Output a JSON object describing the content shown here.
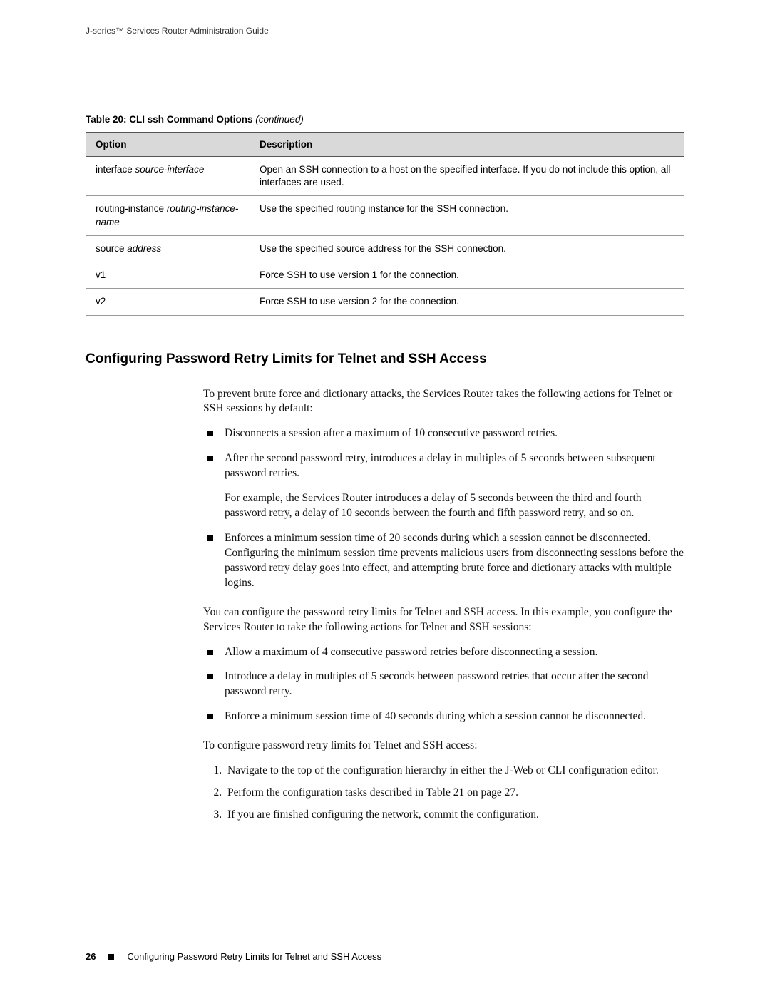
{
  "header": {
    "running": "J-series™ Services Router Administration Guide"
  },
  "table": {
    "caption_bold": "Table 20: CLI ssh Command Options",
    "caption_ital": " (continued)",
    "head_option": "Option",
    "head_desc": "Description",
    "rows": [
      {
        "opt_base": "interface ",
        "opt_param": "source-interface",
        "desc": "Open an SSH connection to a host on the specified interface. If you do not include this option, all interfaces are used."
      },
      {
        "opt_base": "routing-instance ",
        "opt_param": "routing-instance-name",
        "desc": "Use the specified routing instance for the SSH connection."
      },
      {
        "opt_base": "source ",
        "opt_param": "address",
        "desc": "Use the specified source address for the SSH connection."
      },
      {
        "opt_base": "v1",
        "opt_param": "",
        "desc": "Force SSH to use version 1 for the connection."
      },
      {
        "opt_base": "v2",
        "opt_param": "",
        "desc": "Force SSH to use version 2 for the connection."
      }
    ]
  },
  "section": {
    "heading": "Configuring Password Retry Limits for Telnet and SSH Access",
    "intro": "To prevent brute force and dictionary attacks, the Services Router takes the following actions for Telnet or SSH sessions by default:",
    "defaults": [
      {
        "text": "Disconnects a session after a maximum of 10 consecutive password retries."
      },
      {
        "text": "After the second password retry, introduces a delay in multiples of 5 seconds between subsequent password retries.",
        "sub": "For example, the Services Router introduces a delay of 5 seconds between the third and fourth password retry, a delay of 10 seconds between the fourth and fifth password retry, and so on."
      },
      {
        "text": "Enforces a minimum session time of 20 seconds during which a session cannot be disconnected. Configuring the minimum session time prevents malicious users from disconnecting sessions before the password retry delay goes into effect, and attempting brute force and dictionary attacks with multiple logins."
      }
    ],
    "example_intro": "You can configure the password retry limits for Telnet and SSH access. In this example, you configure the Services Router to take the following actions for Telnet and SSH sessions:",
    "example_list": [
      "Allow a maximum of 4 consecutive password retries before disconnecting a session.",
      "Introduce a delay in multiples of 5 seconds between password retries that occur after the second password retry.",
      "Enforce a minimum session time of 40 seconds during which a session cannot be disconnected."
    ],
    "steps_intro": "To configure password retry limits for Telnet and SSH access:",
    "steps": [
      "Navigate to the top of the configuration hierarchy in either the J-Web or CLI configuration editor.",
      "Perform the configuration tasks described in Table 21 on page 27.",
      "If you are finished configuring the network, commit the configuration."
    ]
  },
  "footer": {
    "page": "26",
    "title": "Configuring Password Retry Limits for Telnet and SSH Access"
  }
}
